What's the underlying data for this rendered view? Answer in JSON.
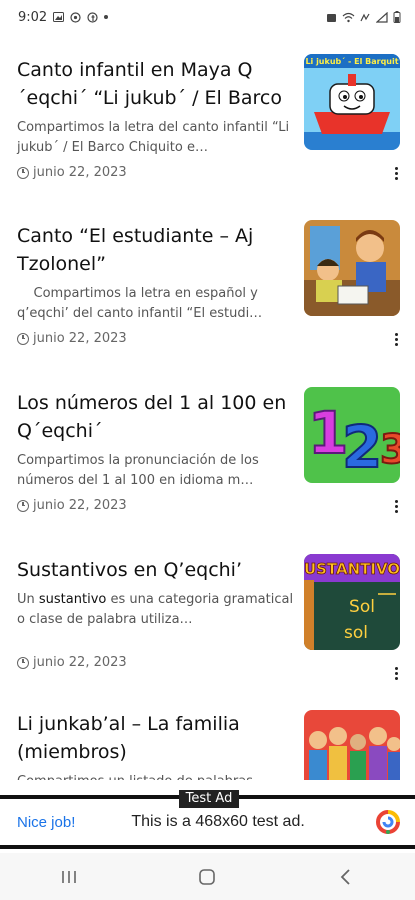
{
  "status_bar": {
    "time": "9:02"
  },
  "articles": [
    {
      "title": "Canto infantil en Maya Q´eqchi´ “Li jukub´ / El Barco",
      "excerpt": "Compartimos la letra del canto infantil “Li jukub´ / El Barco Chiquito e…",
      "date": "junio 22, 2023",
      "thumb_text": "Li jukub´ - El Barquit"
    },
    {
      "title": "Canto “El estudiante – Aj Tzolonel”",
      "excerpt": "    Compartimos la letra en español y q’eqchi’ del canto infantil “El estudi…",
      "date": "junio 22, 2023",
      "thumb_text": ""
    },
    {
      "title": "Los números del 1 al 100 en Q´eqchi´",
      "excerpt": "Compartimos la pronunciación de los números del 1 al 100 en idioma m…",
      "date": "junio 22, 2023",
      "thumb_text": "123"
    },
    {
      "title": "Sustantivos en Q’eqchi’",
      "excerpt_pre": "Un ",
      "excerpt_bold": "sustantivo",
      "excerpt_post": " es una categoria gramatical o clase de palabra utiliza…",
      "date": "junio 22, 2023",
      "thumb_text": "USTANTIVO",
      "thumb_words": [
        "Sol",
        "sol"
      ]
    },
    {
      "title": "Li junkab’al – La familia (miembros)",
      "excerpt": "Compartimos un listado de palabras",
      "date": "",
      "thumb_text": ""
    }
  ],
  "ad": {
    "label": "Test Ad",
    "cta": "Nice job!",
    "text": "This is a 468x60 test ad."
  },
  "colors": {
    "accent": "#1a73e8",
    "text": "#111111",
    "muted": "#555555"
  }
}
